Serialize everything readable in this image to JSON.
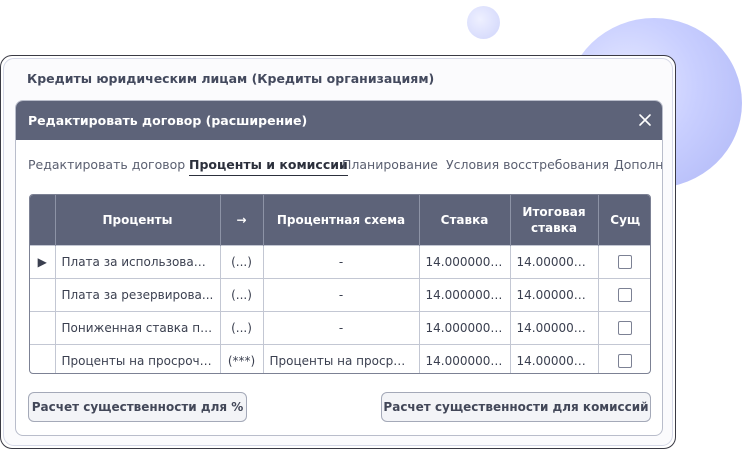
{
  "window": {
    "title": "Кредиты юридическим лицам (Кредиты организациям)"
  },
  "dialog": {
    "title": "Редактировать договор (расширение)",
    "close_glyph": "✕"
  },
  "tabs": [
    {
      "label": "Редактировать договор",
      "active": false
    },
    {
      "label": "Проценты и комиссии",
      "active": true
    },
    {
      "label": "Планирование",
      "active": false
    },
    {
      "label": "Условия восстребования",
      "active": false
    },
    {
      "label": "Дополн",
      "active": false
    }
  ],
  "table": {
    "columns": [
      "",
      "Проценты",
      "→",
      "Процентная схема",
      "Ставка",
      "Итоговая ставка",
      "Сущ"
    ],
    "rows": [
      {
        "marker": "▶",
        "name": "Плата за использование",
        "flag": "(...)",
        "scheme": "-",
        "rate": "14.00000000",
        "total": "14.00000000",
        "checked": false
      },
      {
        "marker": "",
        "name": "Плата за резервирова...",
        "flag": "(...)",
        "scheme": "-",
        "rate": "14.00000000",
        "total": "14.00000000",
        "checked": false
      },
      {
        "marker": "",
        "name": "Пониженная ставка пр...",
        "flag": "(...)",
        "scheme": "-",
        "rate": "14.00000000",
        "total": "14.00000000",
        "checked": false
      },
      {
        "marker": "",
        "name": "Проценты на просроче...",
        "flag": "(***)",
        "scheme": "Проценты на просроч...",
        "rate": "14.00000000",
        "total": "14.00000000",
        "checked": false
      }
    ]
  },
  "buttons": {
    "calc_percent": "Расчет существенности для %",
    "calc_commission": "Расчет существенности для комиссий"
  },
  "colors": {
    "header_bg": "#5d6379",
    "accent_blob": "#aeb6f6"
  }
}
